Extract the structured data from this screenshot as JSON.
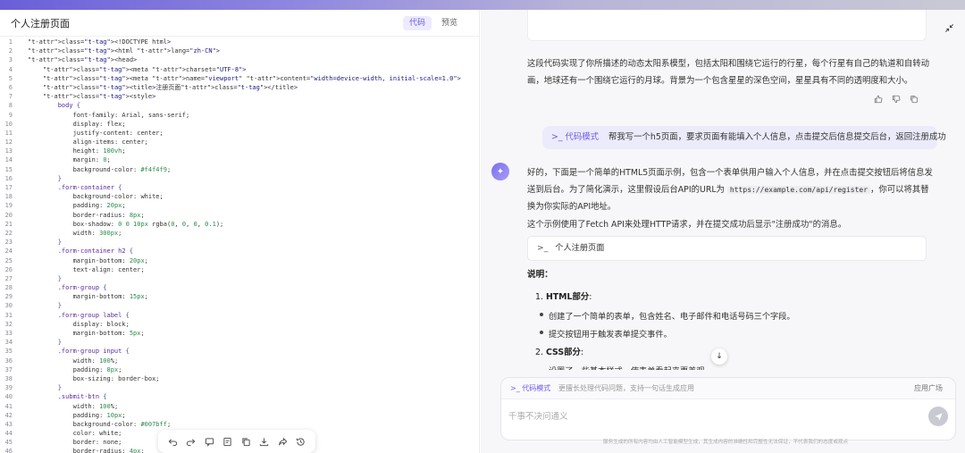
{
  "left_panel": {
    "title": "个人注册页面",
    "tabs": [
      {
        "label": "代码",
        "active": true
      },
      {
        "label": "预览",
        "active": false
      }
    ],
    "code_lines": [
      "<!DOCTYPE html>",
      "<html lang=\"zh-CN\">",
      "<head>",
      "    <meta charset=\"UTF-8\">",
      "    <meta name=\"viewport\" content=\"width=device-width, initial-scale=1.0\">",
      "    <title>注册页面</title>",
      "    <style>",
      "        body {",
      "            font-family: Arial, sans-serif;",
      "            display: flex;",
      "            justify-content: center;",
      "            align-items: center;",
      "            height: 100vh;",
      "            margin: 0;",
      "            background-color: #f4f4f9;",
      "        }",
      "        .form-container {",
      "            background-color: white;",
      "            padding: 20px;",
      "            border-radius: 8px;",
      "            box-shadow: 0 0 10px rgba(0, 0, 0, 0.1);",
      "            width: 300px;",
      "        }",
      "        .form-container h2 {",
      "            margin-bottom: 20px;",
      "            text-align: center;",
      "        }",
      "        .form-group {",
      "            margin-bottom: 15px;",
      "        }",
      "        .form-group label {",
      "            display: block;",
      "            margin-bottom: 5px;",
      "        }",
      "        .form-group input {",
      "            width: 100%;",
      "            padding: 8px;",
      "            box-sizing: border-box;",
      "        }",
      "        .submit-btn {",
      "            width: 100%;",
      "            padding: 10px;",
      "            background-color: #007bff;",
      "            color: white;",
      "            border: none;",
      "            border-radius: 4px;"
    ],
    "toolbar_icons": [
      "undo-icon",
      "redo-icon",
      "comment-icon",
      "edit-icon",
      "copy-icon",
      "download-icon",
      "share-icon",
      "history-icon"
    ]
  },
  "right_panel": {
    "prev_answer_text": "这段代码实现了你所描述的动态太阳系模型，包括太阳和围绕它运行的行星，每个行星有自己的轨道和自转动画，地球还有一个围绕它运行的月球。背景为一个包含星星的深色空间，星星具有不同的透明度和大小。",
    "user_message": {
      "mode": "代码模式",
      "text": "帮我写一个h5页面，要求页面有能填入个人信息，点击提交后信息提交后台，返回注册成功"
    },
    "answer": {
      "intro_1": "好的，下面是一个简单的HTML5页面示例，包含一个表单供用户输入个人信息，并在点击提交按钮后将信息发送到后台。为了简化演示，这里假设后台API的URL为",
      "api_url": "https://example.com/api/register",
      "intro_2": "，你可以将其替换为你实际的API地址。",
      "para_2": "这个示例使用了Fetch API来处理HTTP请求，并在提交成功后显示\"注册成功\"的消息。",
      "code_ref_label": "个人注册页面",
      "explain_heading": "说明：",
      "ol_1_title": "HTML部分",
      "ol_1_items": [
        "创建了一个简单的表单，包含姓名、电子邮件和电话号码三个字段。",
        "提交按钮用于触发表单提交事件。"
      ],
      "ol_2_title": "CSS部分",
      "ol_2_partial": "设置了一些基本样式，使表单看起来更美观。"
    },
    "input": {
      "mode_chip": "代码模式",
      "mode_desc": "更擅长处理代码问题，支持一句话生成应用",
      "app_square": "应用广场",
      "placeholder": "千事不决问通义"
    },
    "disclaimer": "服务生成的所有内容均由人工智能模型生成，其生成内容的准确性和完整性无法保证，不代表我们的态度或观点"
  }
}
